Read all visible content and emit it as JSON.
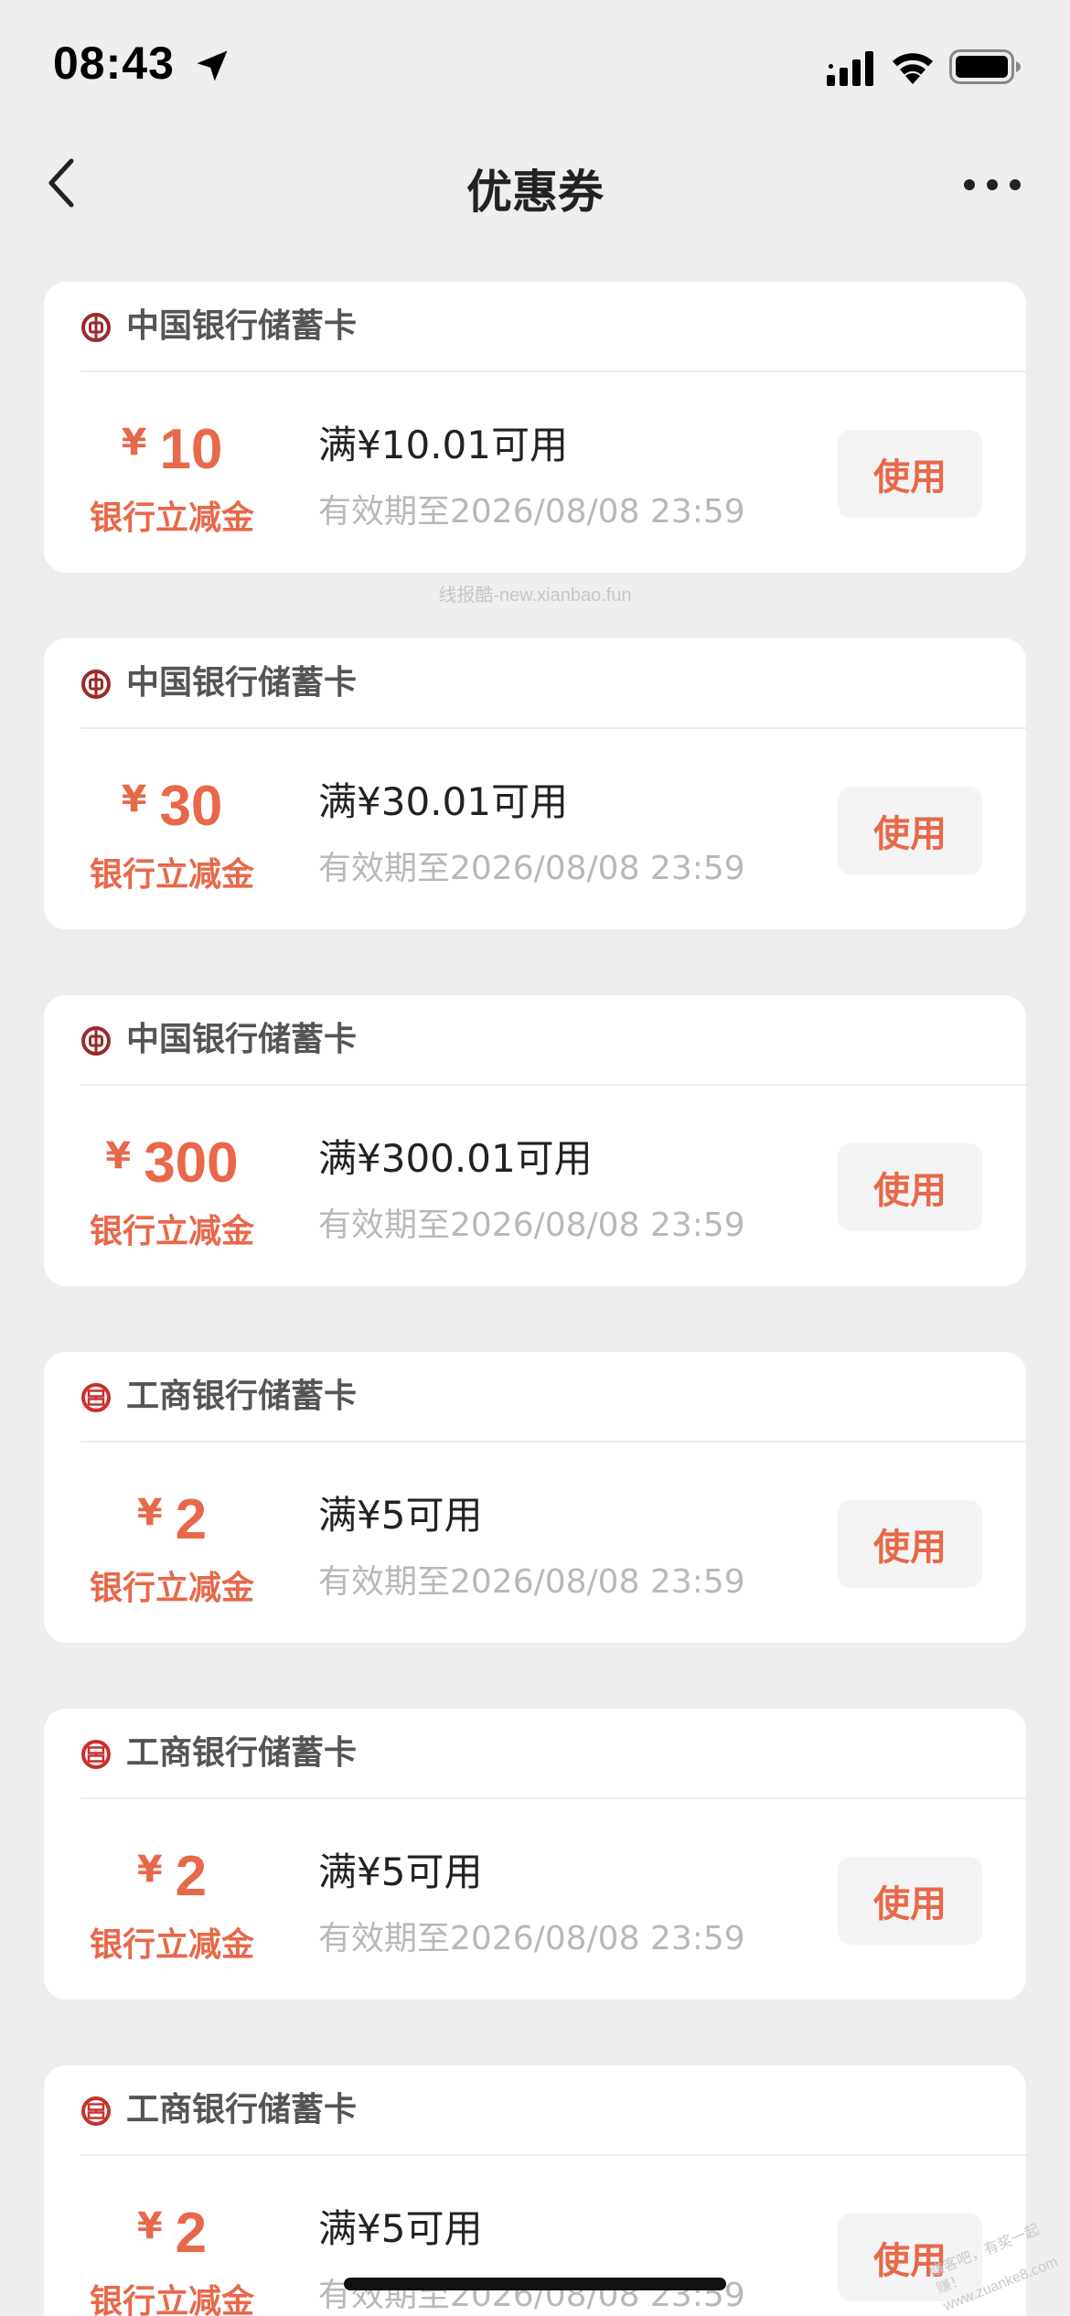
{
  "status_bar": {
    "time": "08:43",
    "icons": [
      "location-arrow-icon",
      "cellular-signal-icon",
      "wifi-icon",
      "battery-icon"
    ]
  },
  "nav": {
    "title": "优惠券",
    "back_icon": "chevron-left-icon",
    "more_icon": "more-dots-icon"
  },
  "colors": {
    "accent": "#e8684a",
    "background": "#eeeeee",
    "card": "#ffffff",
    "boc_logo": "#9b2a2a",
    "icbc_logo": "#c9302c"
  },
  "watermark": {
    "top": "线报酷-new.xianbao.fun",
    "corner_line1": "赚客吧，有奖一起赚！",
    "corner_line2": "www.zuanke8.com"
  },
  "coupons": [
    {
      "bank": "中国银行储蓄卡",
      "bank_icon": "bank-of-china-logo-icon",
      "currency": "¥",
      "amount": "10",
      "amount_label": "银行立减金",
      "condition": "满¥10.01可用",
      "validity": "有效期至2026/08/08 23:59",
      "button": "使用"
    },
    {
      "bank": "中国银行储蓄卡",
      "bank_icon": "bank-of-china-logo-icon",
      "currency": "¥",
      "amount": "30",
      "amount_label": "银行立减金",
      "condition": "满¥30.01可用",
      "validity": "有效期至2026/08/08 23:59",
      "button": "使用"
    },
    {
      "bank": "中国银行储蓄卡",
      "bank_icon": "bank-of-china-logo-icon",
      "currency": "¥",
      "amount": "300",
      "amount_label": "银行立减金",
      "condition": "满¥300.01可用",
      "validity": "有效期至2026/08/08 23:59",
      "button": "使用"
    },
    {
      "bank": "工商银行储蓄卡",
      "bank_icon": "icbc-logo-icon",
      "currency": "¥",
      "amount": "2",
      "amount_label": "银行立减金",
      "condition": "满¥5可用",
      "validity": "有效期至2026/08/08 23:59",
      "button": "使用"
    },
    {
      "bank": "工商银行储蓄卡",
      "bank_icon": "icbc-logo-icon",
      "currency": "¥",
      "amount": "2",
      "amount_label": "银行立减金",
      "condition": "满¥5可用",
      "validity": "有效期至2026/08/08 23:59",
      "button": "使用"
    },
    {
      "bank": "工商银行储蓄卡",
      "bank_icon": "icbc-logo-icon",
      "currency": "¥",
      "amount": "2",
      "amount_label": "银行立减金",
      "condition": "满¥5可用",
      "validity": "有效期至2026/08/08 23:59",
      "button": "使用"
    }
  ]
}
